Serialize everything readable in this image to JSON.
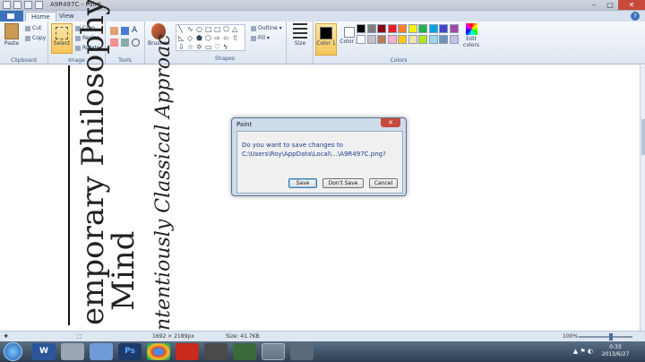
{
  "window": {
    "title": "A9R497C - Paint"
  },
  "tabs": [
    "Home",
    "View"
  ],
  "ribbon": {
    "clipboard": {
      "paste": "Paste",
      "cut": "Cut",
      "copy": "Copy",
      "group_label": "Clipboard"
    },
    "image": {
      "select": "Select",
      "crop": "Crop",
      "resize": "Resize",
      "rotate": "Rotate",
      "group_label": "Image"
    },
    "tools": {
      "group_label": "Tools"
    },
    "brushes": {
      "label": "Brushes"
    },
    "shapes": {
      "outline": "Outline",
      "fill": "Fill",
      "group_label": "Shapes"
    },
    "size": {
      "label": "Size"
    },
    "colors": {
      "color1": "Color 1",
      "color2": "Color 2",
      "edit": "Edit colors",
      "group_label": "Colors",
      "palette": [
        "#000000",
        "#7f7f7f",
        "#880015",
        "#ed1c24",
        "#ff7f27",
        "#fff200",
        "#22b14c",
        "#00a2e8",
        "#3f48cc",
        "#a349a4",
        "#ffffff",
        "#c3c3c3",
        "#b97a57",
        "#ffaec9",
        "#ffc90e",
        "#efe4b0",
        "#b5e61d",
        "#99d9ea",
        "#7092be",
        "#c8bfe7"
      ]
    }
  },
  "canvas": {
    "line1": "emporary Philosophy",
    "line2": "Mind",
    "line3": "ntentiously Classical Approac"
  },
  "statusbar": {
    "dimensions": "1692 × 2189px",
    "size": "Size: 41.7KB",
    "zoom": "100%"
  },
  "dialog": {
    "title": "Paint",
    "message_line1": "Do you want to save changes to",
    "message_line2": "C:\\Users\\Roy\\AppData\\Local\\...\\A9R497C.png?",
    "save": "Save",
    "dont_save": "Don't Save",
    "cancel": "Cancel"
  },
  "taskbar": {
    "apps": [
      "W",
      "",
      "",
      "Ps",
      "",
      "",
      "",
      "",
      "",
      ""
    ],
    "time": "0:33",
    "date": "2013/6/27"
  }
}
